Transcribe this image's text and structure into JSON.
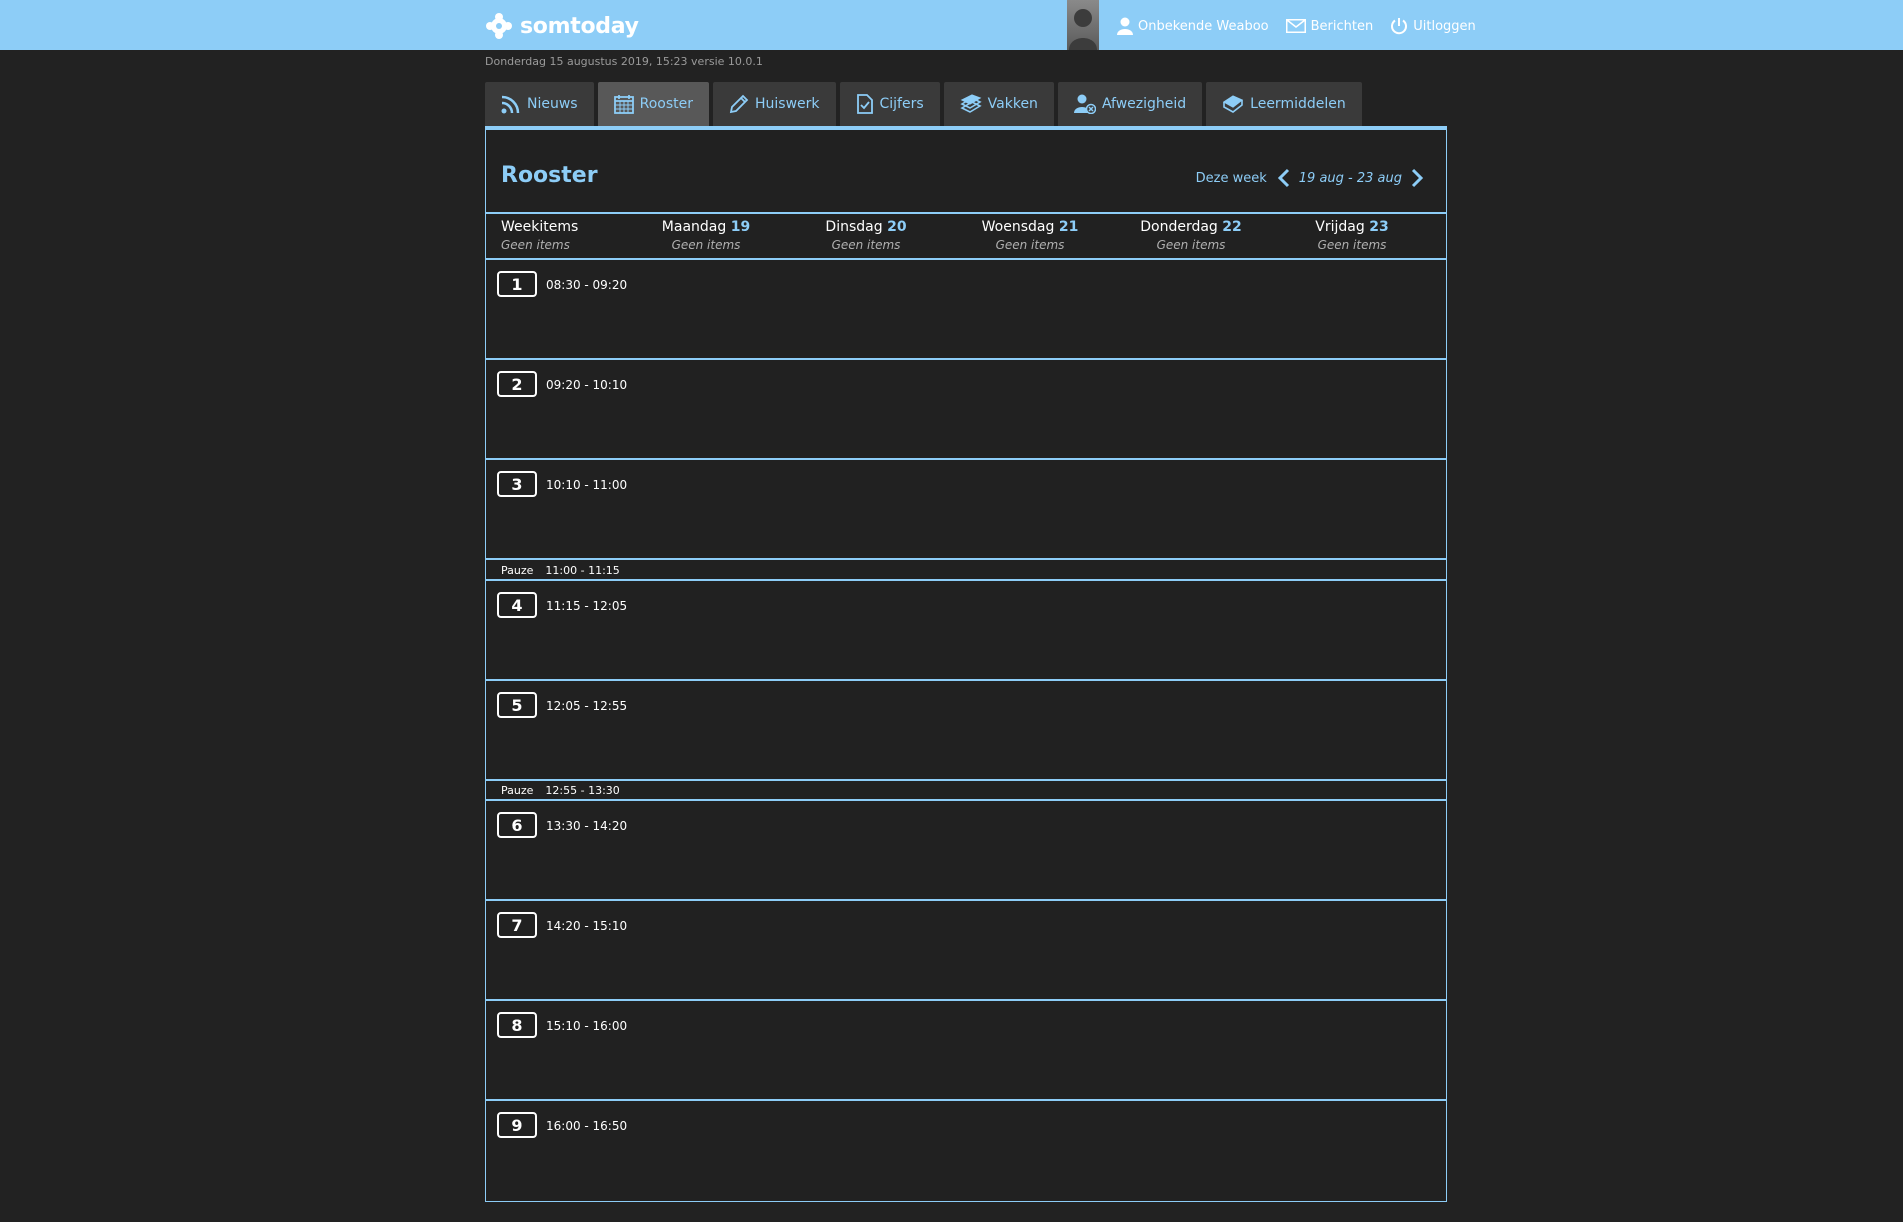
{
  "app": {
    "brand": "somtoday",
    "colors": {
      "accent": "#8dcdf7",
      "background": "#222222",
      "tab": "#3a3a3a",
      "tab_active": "#585858"
    }
  },
  "header": {
    "user": "Onbekende Weaboo",
    "messages": "Berichten",
    "logout": "Uitloggen"
  },
  "datestamp": "Donderdag 15 augustus 2019, 15:23 versie 10.0.1",
  "tabs": [
    {
      "label": "Nieuws",
      "icon": "rss-icon",
      "active": false
    },
    {
      "label": "Rooster",
      "icon": "calendar-icon",
      "active": true
    },
    {
      "label": "Huiswerk",
      "icon": "pencil-icon",
      "active": false
    },
    {
      "label": "Cijfers",
      "icon": "checked-document-icon",
      "active": false
    },
    {
      "label": "Vakken",
      "icon": "books-icon",
      "active": false
    },
    {
      "label": "Afwezigheid",
      "icon": "user-absent-icon",
      "active": false
    },
    {
      "label": "Leermiddelen",
      "icon": "book-icon",
      "active": false
    }
  ],
  "rooster": {
    "title": "Rooster",
    "this_week": "Deze week",
    "range": "19 aug - 23 aug",
    "columns": [
      {
        "name": "Weekitems",
        "num": "",
        "empty": "Geen items"
      },
      {
        "name": "Maandag",
        "num": "19",
        "empty": "Geen items"
      },
      {
        "name": "Dinsdag",
        "num": "20",
        "empty": "Geen items"
      },
      {
        "name": "Woensdag",
        "num": "21",
        "empty": "Geen items"
      },
      {
        "name": "Donderdag",
        "num": "22",
        "empty": "Geen items"
      },
      {
        "name": "Vrijdag",
        "num": "23",
        "empty": "Geen items"
      }
    ],
    "periods": [
      {
        "num": "1",
        "time": "08:30 - 09:20"
      },
      {
        "num": "2",
        "time": "09:20 - 10:10"
      },
      {
        "num": "3",
        "time": "10:10 - 11:00"
      },
      {
        "num": "4",
        "time": "11:15 - 12:05"
      },
      {
        "num": "5",
        "time": "12:05 - 12:55"
      },
      {
        "num": "6",
        "time": "13:30 - 14:20"
      },
      {
        "num": "7",
        "time": "14:20 - 15:10"
      },
      {
        "num": "8",
        "time": "15:10 - 16:00"
      },
      {
        "num": "9",
        "time": "16:00 - 16:50"
      }
    ],
    "breaks": [
      {
        "label": "Pauze",
        "time": "11:00 - 11:15"
      },
      {
        "label": "Pauze",
        "time": "12:55 - 13:30"
      }
    ]
  }
}
